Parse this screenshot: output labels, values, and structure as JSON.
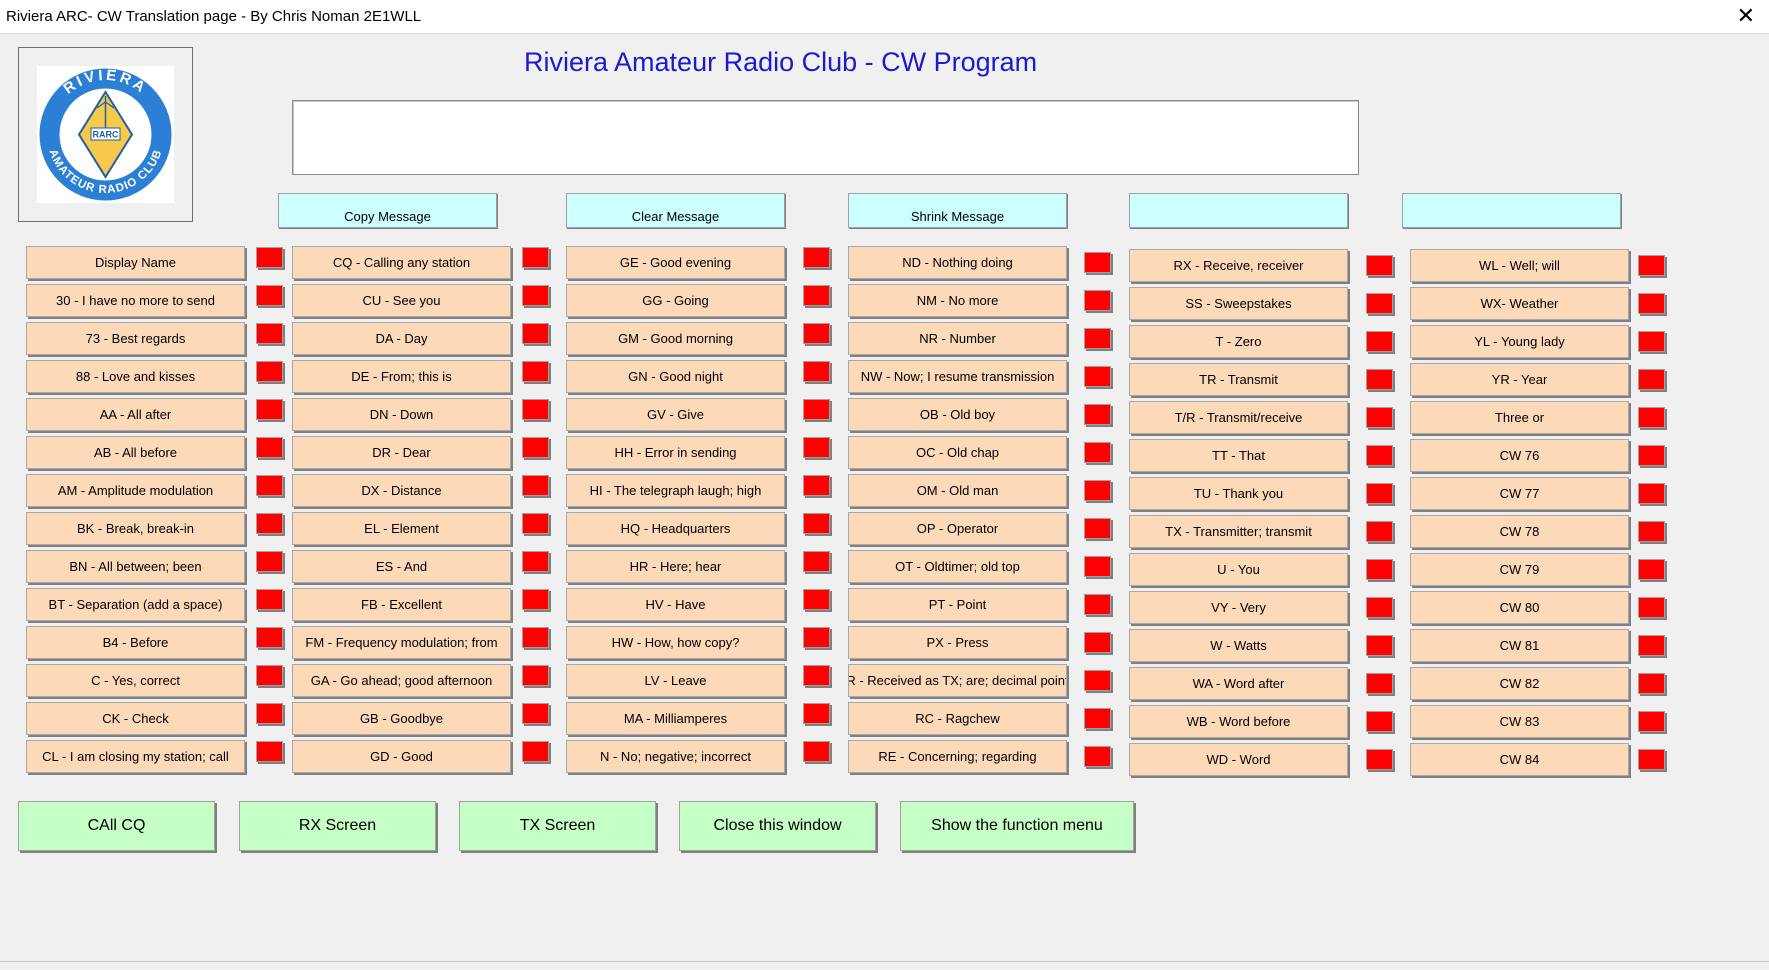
{
  "window": {
    "title": "Riviera ARC- CW Translation page - By Chris Noman 2E1WLL",
    "close_glyph": "✕"
  },
  "logo": {
    "top_text": "RIVIERA",
    "bottom_text": "AMATEUR RADIO CLUB",
    "center_text": "RARC"
  },
  "heading": "Riviera Amateur Radio Club - CW Program",
  "message_box": {
    "value": "",
    "placeholder": ""
  },
  "top_buttons": [
    "Copy Message",
    "Clear Message",
    "Shrink Message",
    "",
    ""
  ],
  "columns": [
    [
      "Display Name",
      "30 - I have no more to send",
      "73 - Best regards",
      "88 - Love and kisses",
      "AA - All after",
      "AB - All before",
      "AM - Amplitude modulation",
      "BK - Break, break-in",
      "BN - All between; been",
      "BT - Separation (add a space)",
      "B4 - Before",
      "C - Yes, correct",
      "CK - Check",
      "CL - I am closing my station; call"
    ],
    [
      "CQ - Calling any station",
      "CU - See you",
      "DA - Day",
      "DE - From; this is",
      "DN - Down",
      "DR - Dear",
      "DX - Distance",
      "EL - Element",
      "ES - And",
      "FB - Excellent",
      "FM - Frequency modulation; from",
      "GA - Go ahead; good afternoon",
      "GB - Goodbye",
      "GD - Good"
    ],
    [
      "GE - Good evening",
      "GG - Going",
      "GM - Good morning",
      "GN - Good night",
      "GV - Give",
      "HH - Error in sending",
      "HI - The telegraph laugh; high",
      "HQ - Headquarters",
      "HR - Here; hear",
      "HV - Have",
      "HW - How, how copy?",
      "LV - Leave",
      "MA - Milliamperes",
      "N - No; negative; incorrect"
    ],
    [
      "ND - Nothing doing",
      "NM - No more",
      "NR - Number",
      "NW - Now; I resume transmission",
      "OB - Old boy",
      "OC - Old chap",
      "OM - Old man",
      "OP - Operator",
      "OT - Oldtimer; old top",
      "PT - Point",
      "PX - Press",
      "R - Received as TX; are; decimal point",
      "RC - Ragchew",
      "RE - Concerning; regarding"
    ],
    [
      "RX - Receive, receiver",
      "SS - Sweepstakes",
      "T - Zero",
      "TR - Transmit",
      "T/R - Transmit/receive",
      "TT - That",
      "TU - Thank you",
      "TX - Transmitter; transmit",
      "U - You",
      "VY - Very",
      "W - Watts",
      "WA - Word after",
      "WB - Word before",
      "WD - Word"
    ],
    [
      "WL - Well; will",
      "WX- Weather",
      "YL - Young lady",
      "YR - Year",
      "Three or",
      "CW 76",
      "CW 77",
      "CW 78",
      "CW 79",
      "CW 80",
      "CW 81",
      "CW 82",
      "CW 83",
      "CW 84"
    ]
  ],
  "bottom_buttons": [
    "CAll CQ",
    "RX Screen",
    "TX Screen",
    "Close this window",
    "Show the function menu"
  ],
  "colors": {
    "heading": "#1a1ad0",
    "cw_button": "#fcd9b8",
    "indicator": "#ff0000",
    "top_button": "#ccffff",
    "bottom_button": "#c6ffc6",
    "logo_ring": "#2b7fd4",
    "logo_diamond": "#f6c94a"
  }
}
